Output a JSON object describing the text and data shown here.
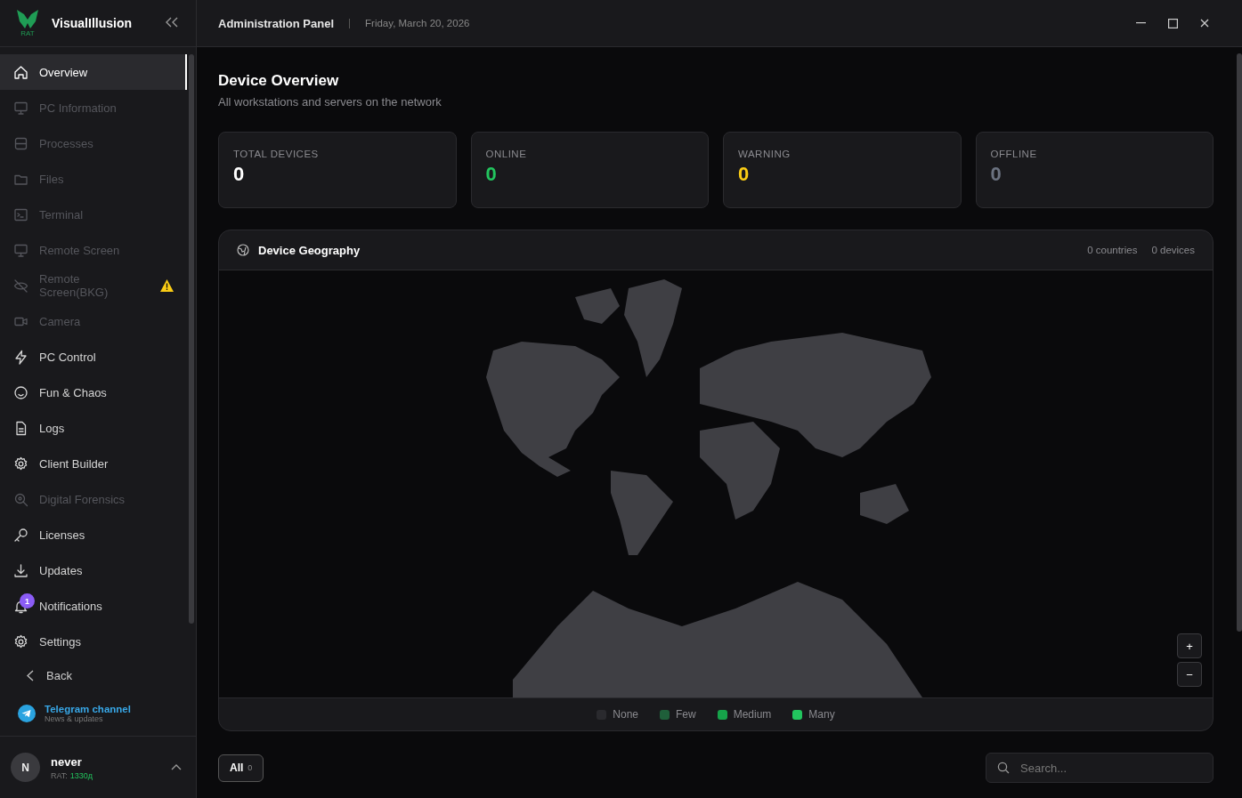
{
  "app": {
    "name": "VisualIllusion",
    "logo_caption": "RAT"
  },
  "sidebar": {
    "items": [
      {
        "label": "Overview",
        "selected": true,
        "disabled": false
      },
      {
        "label": "PC Information",
        "selected": false,
        "disabled": true
      },
      {
        "label": "Processes",
        "selected": false,
        "disabled": true
      },
      {
        "label": "Files",
        "selected": false,
        "disabled": true
      },
      {
        "label": "Terminal",
        "selected": false,
        "disabled": true
      },
      {
        "label": "Remote Screen",
        "selected": false,
        "disabled": true
      },
      {
        "label": "Remote Screen(BKG)",
        "selected": false,
        "disabled": true,
        "warning": true
      },
      {
        "label": "Camera",
        "selected": false,
        "disabled": true
      },
      {
        "label": "PC Control",
        "selected": false,
        "disabled": false
      },
      {
        "label": "Fun & Chaos",
        "selected": false,
        "disabled": false
      },
      {
        "label": "Logs",
        "selected": false,
        "disabled": false
      },
      {
        "label": "Client Builder",
        "selected": false,
        "disabled": false
      },
      {
        "label": "Digital Forensics",
        "selected": false,
        "disabled": true
      },
      {
        "label": "Licenses",
        "selected": false,
        "disabled": false
      },
      {
        "label": "Updates",
        "selected": false,
        "disabled": false
      },
      {
        "label": "Notifications",
        "selected": false,
        "disabled": false,
        "badge": "1"
      },
      {
        "label": "Settings",
        "selected": false,
        "disabled": false
      }
    ],
    "back": "Back",
    "telegram": {
      "title": "Telegram channel",
      "subtitle": "News & updates"
    },
    "user": {
      "initial": "N",
      "name": "never",
      "plan_label": "RAT:",
      "plan_value": "1330д"
    }
  },
  "header": {
    "title": "Administration Panel",
    "date": "Friday, March 20, 2026"
  },
  "page": {
    "title": "Device Overview",
    "subtitle": "All workstations and servers on the network"
  },
  "stats": [
    {
      "label": "TOTAL DEVICES",
      "value": "0",
      "color": "#ffffff"
    },
    {
      "label": "ONLINE",
      "value": "0",
      "color": "#22c55e"
    },
    {
      "label": "WARNING",
      "value": "0",
      "color": "#facc15"
    },
    {
      "label": "OFFLINE",
      "value": "0",
      "color": "#6b7280"
    }
  ],
  "geography": {
    "title": "Device Geography",
    "countries": "0 countries",
    "devices": "0 devices",
    "zoom_in": "+",
    "zoom_out": "−",
    "legend": [
      {
        "label": "None",
        "color": "#2a2a2e"
      },
      {
        "label": "Few",
        "color": "#1f5f3a"
      },
      {
        "label": "Medium",
        "color": "#16a34a"
      },
      {
        "label": "Many",
        "color": "#22c55e"
      }
    ]
  },
  "filter": {
    "label": "All",
    "count": "0"
  },
  "search": {
    "placeholder": "Search..."
  }
}
